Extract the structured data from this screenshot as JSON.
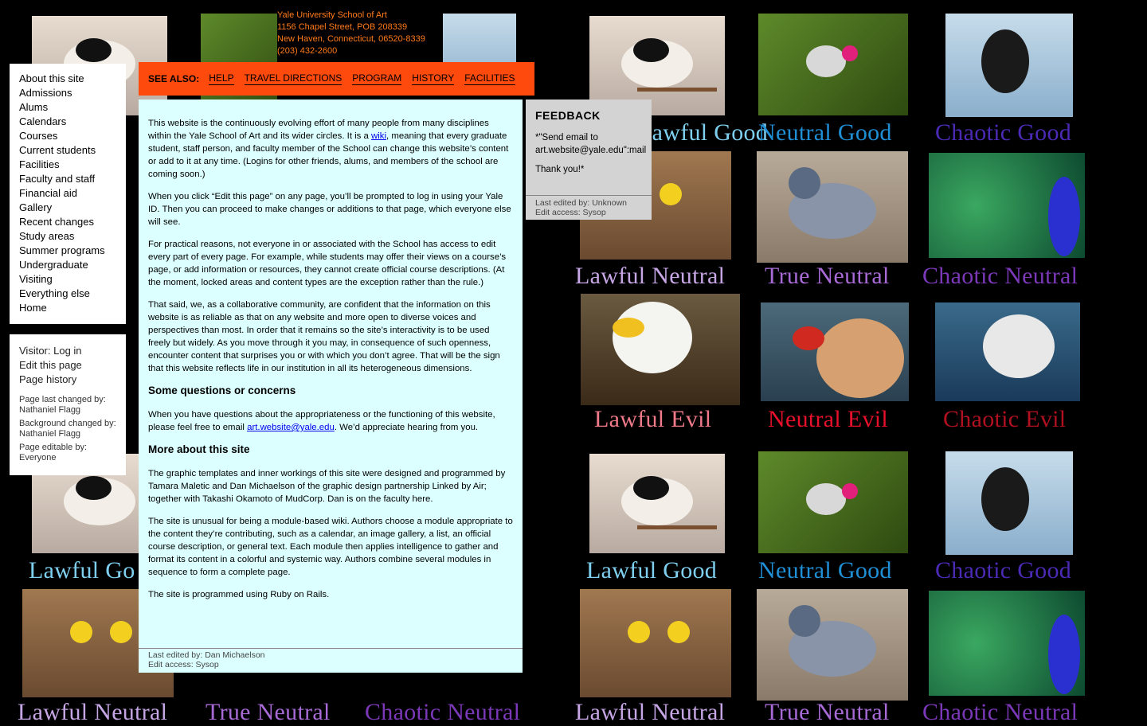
{
  "address": {
    "line1": "Yale University School of Art",
    "line2": "1156 Chapel Street, POB 208339",
    "line3": "New Haven, Connecticut, 06520-8339",
    "line4": "(203) 432-2600"
  },
  "nav": {
    "items": [
      {
        "label": "About this site"
      },
      {
        "label": "Admissions"
      },
      {
        "label": "Alums"
      },
      {
        "label": "Calendars"
      },
      {
        "label": "Courses"
      },
      {
        "label": "Current students"
      },
      {
        "label": "Facilities"
      },
      {
        "label": "Faculty and staff"
      },
      {
        "label": "Financial aid"
      },
      {
        "label": "Gallery"
      },
      {
        "label": "Recent changes"
      },
      {
        "label": "Study areas"
      },
      {
        "label": "Summer programs"
      },
      {
        "label": "Undergraduate"
      },
      {
        "label": "Visiting"
      },
      {
        "label": "Everything else"
      },
      {
        "label": "Home"
      }
    ]
  },
  "user": {
    "login": "Visitor: Log in",
    "edit": "Edit this page",
    "history": "Page history",
    "changed_by_label": "Page last changed by:",
    "changed_by": "Nathaniel Flagg",
    "bg_changed_label": "Background changed by:",
    "bg_changed_by": "Nathaniel Flagg",
    "editable_label": "Page editable by:",
    "editable_by": "Everyone"
  },
  "seealso": {
    "label": "SEE ALSO:",
    "links": [
      "HELP",
      "TRAVEL DIRECTIONS",
      "PROGRAM",
      "HISTORY",
      "FACILITIES"
    ]
  },
  "main": {
    "p1a": "This website is the continuously evolving effort of many people from many disciplines within the Yale School of Art and its wider circles. It is a ",
    "p1link": "wiki",
    "p1b": ", meaning that every graduate student, staff person, and faculty member of the School can change this website’s content or add to it at any time. (Logins for other friends, alums, and members of the school are coming soon.)",
    "p2": "When you click “Edit this page” on any page, you’ll be prompted to log in using your Yale ID. Then you can proceed to make changes or additions to that page, which everyone else will see.",
    "p3": "For practical reasons, not everyone in or associated with the School has access to edit every part of every page. For example, while students may offer their views on a course’s page, or add information or resources, they cannot create official course descriptions. (At the moment, locked areas and content types are the exception rather than the rule.)",
    "p4": "That said, we, as a collaborative community, are confident that the information on this website is as reliable as that on any website and more open to diverse voices and perspectives than most. In order that it remains so the site’s interactivity is to be used freely but widely. As you move through it you may, in consequence of such openness, encounter content that surprises you or with which you don’t agree. That will be the sign that this website reflects life in our institution in all its heterogeneous dimensions.",
    "h2": "Some questions or concerns",
    "p5a": "When you have questions about the appropriateness or the functioning of this website, please feel free to email ",
    "p5link": "art.website@yale.edu",
    "p5b": ". We’d appreciate hearing from you.",
    "h3": "More about this site",
    "p6": "The graphic templates and inner workings of this site were designed and programmed by Tamara Maletic and Dan Michaelson of the graphic design partnership Linked by Air; together with Takashi Okamoto of MudCorp. Dan is on the faculty here.",
    "p7": "The site is unusual for being a module-based wiki. Authors choose a module appropriate to the content they’re contributing, such as a calendar, an image gallery, a list, an official course description, or general text. Each module then applies intelligence to gather and format its content in a colorful and systemic way. Authors combine several modules in sequence to form a complete page.",
    "p8": "The site is programmed using Ruby on Rails.",
    "edited": "Last edited by: Dan Michaelson",
    "access": "Edit access: Sysop"
  },
  "feedback": {
    "title": "FEEDBACK",
    "line1": "*\"Send email to",
    "line2": "art.website@yale.edu\":mail",
    "line3": "Thank you!*",
    "edited": "Last edited by: Unknown",
    "access": "Edit access: Sysop"
  },
  "background": {
    "captions": {
      "lg_left": "Lawful Go",
      "ln_left": "Lawful Neutral",
      "tn_left": "True Neutral",
      "cn_left": "Chaotic Neutral",
      "lg1": "Lawful Good",
      "ng1": "Neutral Good",
      "cg1": "Chaotic Good",
      "ln1": "Lawful Neutral",
      "tn1": "True Neutral",
      "cn1": "Chaotic Neutral",
      "le1": "Lawful Evil",
      "ne1": "Neutral Evil",
      "ce1": "Chaotic Evil",
      "lg2": "Lawful Good",
      "ng2": "Neutral Good",
      "cg2": "Chaotic Good",
      "ln2": "Lawful Neutral",
      "tn2": "True Neutral",
      "cn2": "Chaotic Neutral"
    },
    "colors": {
      "lawful_good": "#7fd0f0",
      "neutral_good": "#1f8fd6",
      "chaotic_good": "#4b2ab5",
      "lawful_neutral": "#c7a6e6",
      "true_neutral": "#a86ad6",
      "chaotic_neutral": "#7b38b8",
      "lawful_evil": "#f07a8a",
      "neutral_evil": "#e8102a",
      "chaotic_evil": "#b01020"
    }
  }
}
